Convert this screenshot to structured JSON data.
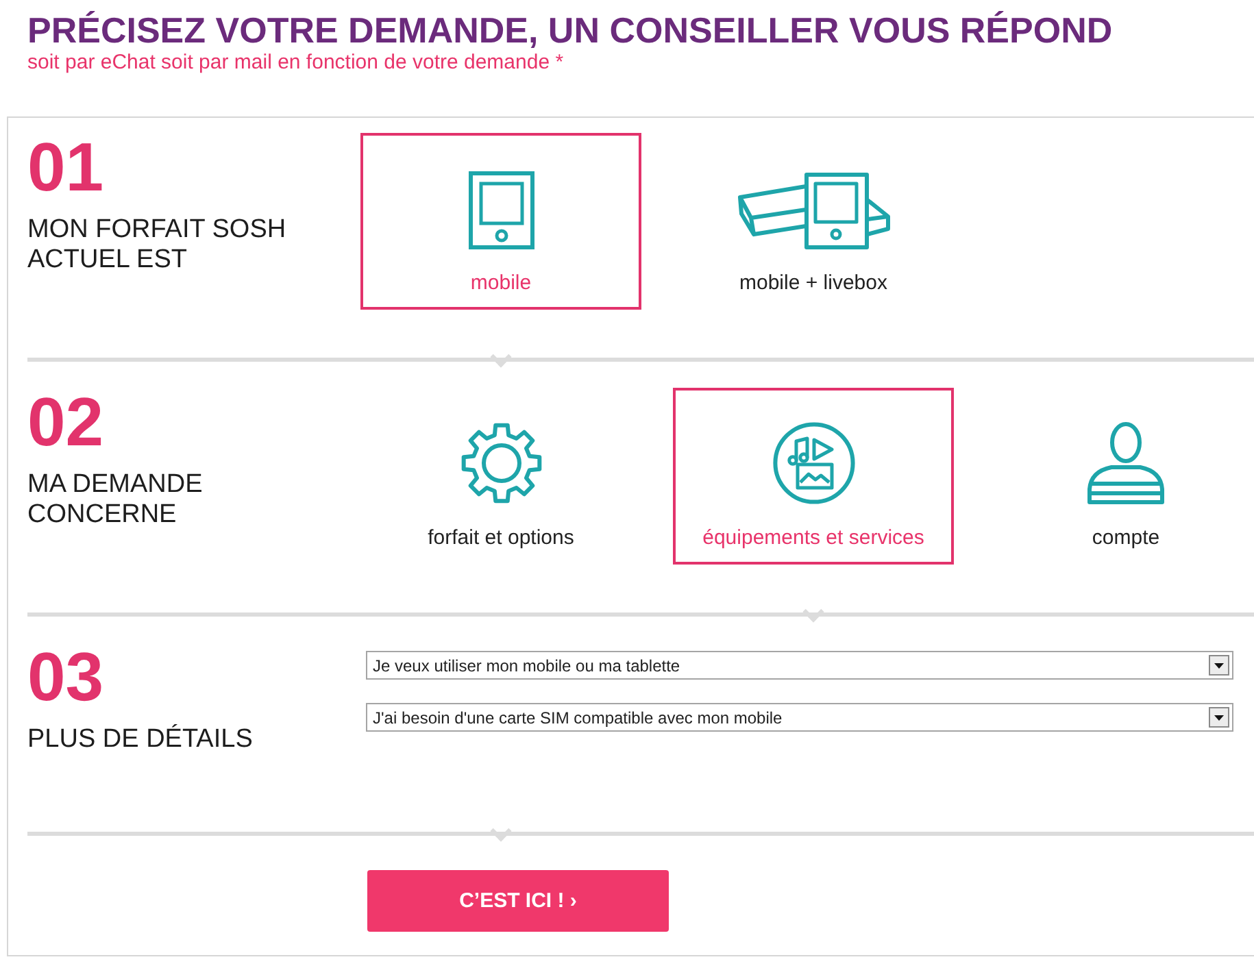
{
  "header": {
    "title": "PRÉCISEZ VOTRE DEMANDE, UN CONSEILLER VOUS RÉPOND",
    "subtitle": "soit par eChat soit par mail en fonction de votre demande *"
  },
  "steps": [
    {
      "kind": "choices",
      "number": "01",
      "label": "MON FORFAIT SOSH ACTUEL EST",
      "options": [
        {
          "label": "mobile",
          "selected": true
        },
        {
          "label": "mobile + livebox",
          "selected": false
        }
      ]
    },
    {
      "kind": "choices",
      "number": "02",
      "label": "MA DEMANDE CONCERNE",
      "options": [
        {
          "label": "forfait et options",
          "selected": false
        },
        {
          "label": "équipements et services",
          "selected": true
        },
        {
          "label": "compte",
          "selected": false
        }
      ]
    },
    {
      "kind": "details",
      "number": "03",
      "label": "PLUS DE DÉTAILS",
      "selects": [
        {
          "value": "Je veux utiliser mon mobile ou ma tablette"
        },
        {
          "value": "J'ai besoin d'une carte SIM compatible avec mon mobile"
        }
      ]
    }
  ],
  "submit": {
    "label": "C’EST ICI ! ›"
  }
}
